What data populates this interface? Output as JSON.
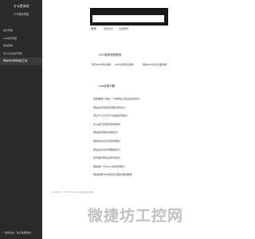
{
  "sidebar": {
    "title": "卡卡提米网",
    "subtitle": "卡卡提米导航",
    "items": [
      {
        "label": "站长导航",
        "active": false
      },
      {
        "label": "seo优化导航",
        "active": false
      },
      {
        "label": "建站导航",
        "active": false
      },
      {
        "label": "中小企业站长导航",
        "active": false
      },
      {
        "label": "网站优化教程收集汇编",
        "active": true
      }
    ],
    "footer": "一键搜全站 · 站点地图导航"
  },
  "search": {
    "tabs": [
      {
        "label": "百度",
        "active": true
      },
      {
        "label": "搜狗",
        "active": false
      },
      {
        "label": "谷歌",
        "active": false
      },
      {
        "label": "360",
        "active": false
      }
    ],
    "input_value": "",
    "placeholder": "",
    "button_label": "搜索",
    "hot_words": [
      "百度优化",
      "百度推荐"
    ]
  },
  "section1": {
    "title": "SEO推荐视频教程",
    "items": [
      "网页SEO优化编辑",
      "SEO全网优化服务",
      "网站SEO优化全面讲解"
    ]
  },
  "section2": {
    "title": "seo经典问题",
    "questions": [
      "我想要推广网站一个新网站上线后如何优化?",
      "网站的内页和首页要怎样优化?",
      "通过什么方法可以快速提高排名?",
      "怎么提升百度搜索的权重?",
      "网站如何做好内容优化?",
      "网站优化常见问题有哪些?",
      "网站在优化时有哪些技巧?",
      "如何做好网站关键词优化?",
      "网站推广方法seo具体有哪些?",
      "网站根据SEO优化的过程有哪些要素?"
    ]
  },
  "footer": {
    "text": "Copyright © 2017-2018 卡卡提米网 版权所有"
  },
  "watermark": "微捷坊工控网"
}
